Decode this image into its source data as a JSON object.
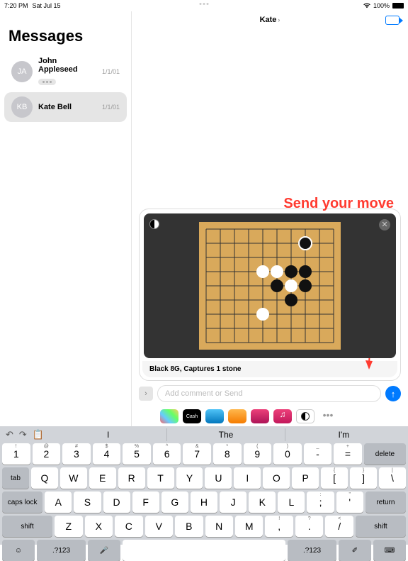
{
  "status": {
    "time": "7:20 PM",
    "date": "Sat Jul 15",
    "wifi": "wifi-icon",
    "battery_pct": "100%"
  },
  "sidebar": {
    "title": "Messages",
    "items": [
      {
        "initials": "JA",
        "name": "John Appleseed",
        "date": "1/1/01"
      },
      {
        "initials": "KB",
        "name": "Kate Bell",
        "date": "1/1/01"
      }
    ]
  },
  "chat": {
    "title": "Kate"
  },
  "annotation": "Send  your move",
  "attachment": {
    "caption": "Black 8G, Captures 1 stone"
  },
  "input": {
    "placeholder": "Add comment or Send"
  },
  "apps": {
    "cash": "Cash",
    "more": "•••"
  },
  "keyboard": {
    "suggestions": [
      "I",
      "The",
      "I'm"
    ],
    "row1": [
      {
        "m": "1",
        "s": "!"
      },
      {
        "m": "2",
        "s": "@"
      },
      {
        "m": "3",
        "s": "#"
      },
      {
        "m": "4",
        "s": "$"
      },
      {
        "m": "5",
        "s": "%"
      },
      {
        "m": "6",
        "s": "^"
      },
      {
        "m": "7",
        "s": "&"
      },
      {
        "m": "8",
        "s": "*"
      },
      {
        "m": "9",
        "s": "("
      },
      {
        "m": "0",
        "s": ")"
      },
      {
        "m": "-",
        "s": "_"
      },
      {
        "m": "=",
        "s": "+"
      }
    ],
    "row2": [
      "Q",
      "W",
      "E",
      "R",
      "T",
      "Y",
      "U",
      "I",
      "O",
      "P"
    ],
    "row2_extra": [
      {
        "m": "[",
        "s": "{"
      },
      {
        "m": "]",
        "s": "}"
      }
    ],
    "row3": [
      "A",
      "S",
      "D",
      "F",
      "G",
      "H",
      "J",
      "K",
      "L"
    ],
    "row3_extra": [
      {
        "m": ";",
        "s": ":"
      },
      {
        "m": "'",
        "s": "\""
      }
    ],
    "row4": [
      "Z",
      "X",
      "C",
      "V",
      "B",
      "N",
      "M"
    ],
    "row4_extra": [
      {
        "m": ",",
        "s": "!"
      },
      {
        "m": ".",
        "s": "?"
      },
      {
        "m": "/",
        "s": "<"
      }
    ],
    "fn": {
      "delete": "delete",
      "tab": "tab",
      "caps": "caps lock",
      "return": "return",
      "shift": "shift",
      "numbers": ".?123",
      "scribble": "✐"
    }
  }
}
